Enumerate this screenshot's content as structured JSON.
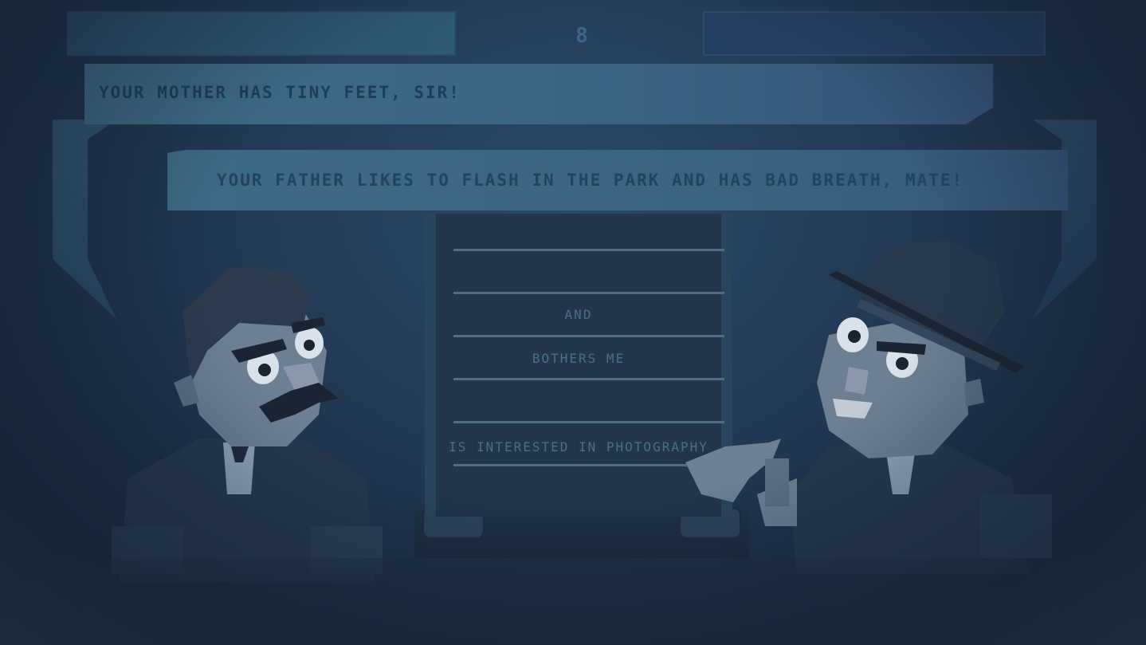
{
  "hud": {
    "round_number": "8"
  },
  "insults": {
    "top": "YOUR MOTHER HAS TINY FEET, SIR!",
    "middle": "YOUR FATHER LIKES TO FLASH IN THE PARK AND HAS BAD BREATH, MATE!"
  },
  "word_slots": [
    "",
    "AND",
    "BOTHERS ME",
    "",
    "IS INTERESTED IN PHOTOGRAPHY"
  ],
  "characters": {
    "left": "mustached-gentleman",
    "right": "bowler-hat-gentleman"
  },
  "colors": {
    "background": "#1e2c3f",
    "bubble": "#3f6c86",
    "text": "#1f3d54",
    "slot_text": "#4b6f88"
  }
}
